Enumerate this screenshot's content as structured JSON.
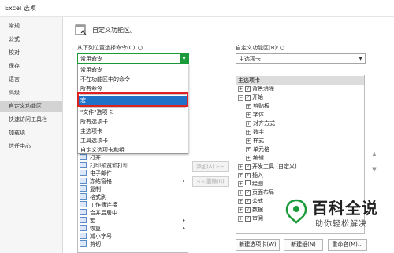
{
  "window": {
    "title": "Excel 选项"
  },
  "sidebar": {
    "items": [
      {
        "label": "常规"
      },
      {
        "label": "公式"
      },
      {
        "label": "校对"
      },
      {
        "label": "保存"
      },
      {
        "label": "语言"
      },
      {
        "label": "高级"
      },
      {
        "label": "自定义功能区"
      },
      {
        "label": "快速访问工具栏"
      },
      {
        "label": "加载项"
      },
      {
        "label": "信任中心"
      }
    ],
    "active": "自定义功能区"
  },
  "header": {
    "title": "自定义功能区。"
  },
  "left": {
    "choose_label": "从下列位置选择命令(C):",
    "combo_value": "常用命令",
    "dropdown_options": [
      {
        "label": "常用命令"
      },
      {
        "label": "不在功能区中的命令"
      },
      {
        "label": "所有命令"
      },
      {
        "label": "宏"
      },
      {
        "label": "\"文件\"选项卡"
      },
      {
        "label": "所有选项卡"
      },
      {
        "label": "主选项卡"
      },
      {
        "label": "工具选项卡"
      },
      {
        "label": "自定义选项卡和组"
      }
    ],
    "selected_option": "宏",
    "commands": [
      {
        "label": "打开"
      },
      {
        "label": "打印预览和打印"
      },
      {
        "label": "电子邮件"
      },
      {
        "label": "冻结窗格"
      },
      {
        "label": "复制"
      },
      {
        "label": "格式刷"
      },
      {
        "label": "工作簿连接"
      },
      {
        "label": "合并后居中"
      },
      {
        "label": "宏"
      },
      {
        "label": "恢复"
      },
      {
        "label": "减小字号"
      },
      {
        "label": "剪切"
      }
    ]
  },
  "middle": {
    "add_label": "添加(A) >>",
    "remove_label": "<< 删除(R)"
  },
  "right": {
    "customize_label": "自定义功能区(B):",
    "combo_value": "主选项卡",
    "tree_header": "主选项卡",
    "tree": [
      {
        "label": "背景消除",
        "checked": true,
        "level": 0
      },
      {
        "label": "开始",
        "checked": true,
        "level": 0
      },
      {
        "label": "剪贴板",
        "level": 1
      },
      {
        "label": "字体",
        "level": 1
      },
      {
        "label": "对齐方式",
        "level": 1
      },
      {
        "label": "数字",
        "level": 1
      },
      {
        "label": "样式",
        "level": 1
      },
      {
        "label": "单元格",
        "level": 1
      },
      {
        "label": "编辑",
        "level": 1
      },
      {
        "label": "开发工具 (自定义)",
        "checked": true,
        "level": 0
      },
      {
        "label": "插入",
        "checked": true,
        "level": 0
      },
      {
        "label": "绘图",
        "checked": false,
        "level": 0
      },
      {
        "label": "页面布局",
        "checked": true,
        "level": 0
      },
      {
        "label": "公式",
        "checked": true,
        "level": 0
      },
      {
        "label": "数据",
        "checked": true,
        "level": 0
      },
      {
        "label": "审阅",
        "checked": true,
        "level": 0
      }
    ],
    "new_tab_label": "新建选项卡(W)",
    "new_group_label": "新建组(N)",
    "rename_label": "重命名(M)..."
  },
  "watermark": {
    "title": "百科全说",
    "subtitle": "助你轻松解决"
  },
  "colors": {
    "accent_green": "#1c9b3b",
    "selection_blue": "#1e72c8",
    "highlight_red": "#e02020"
  }
}
